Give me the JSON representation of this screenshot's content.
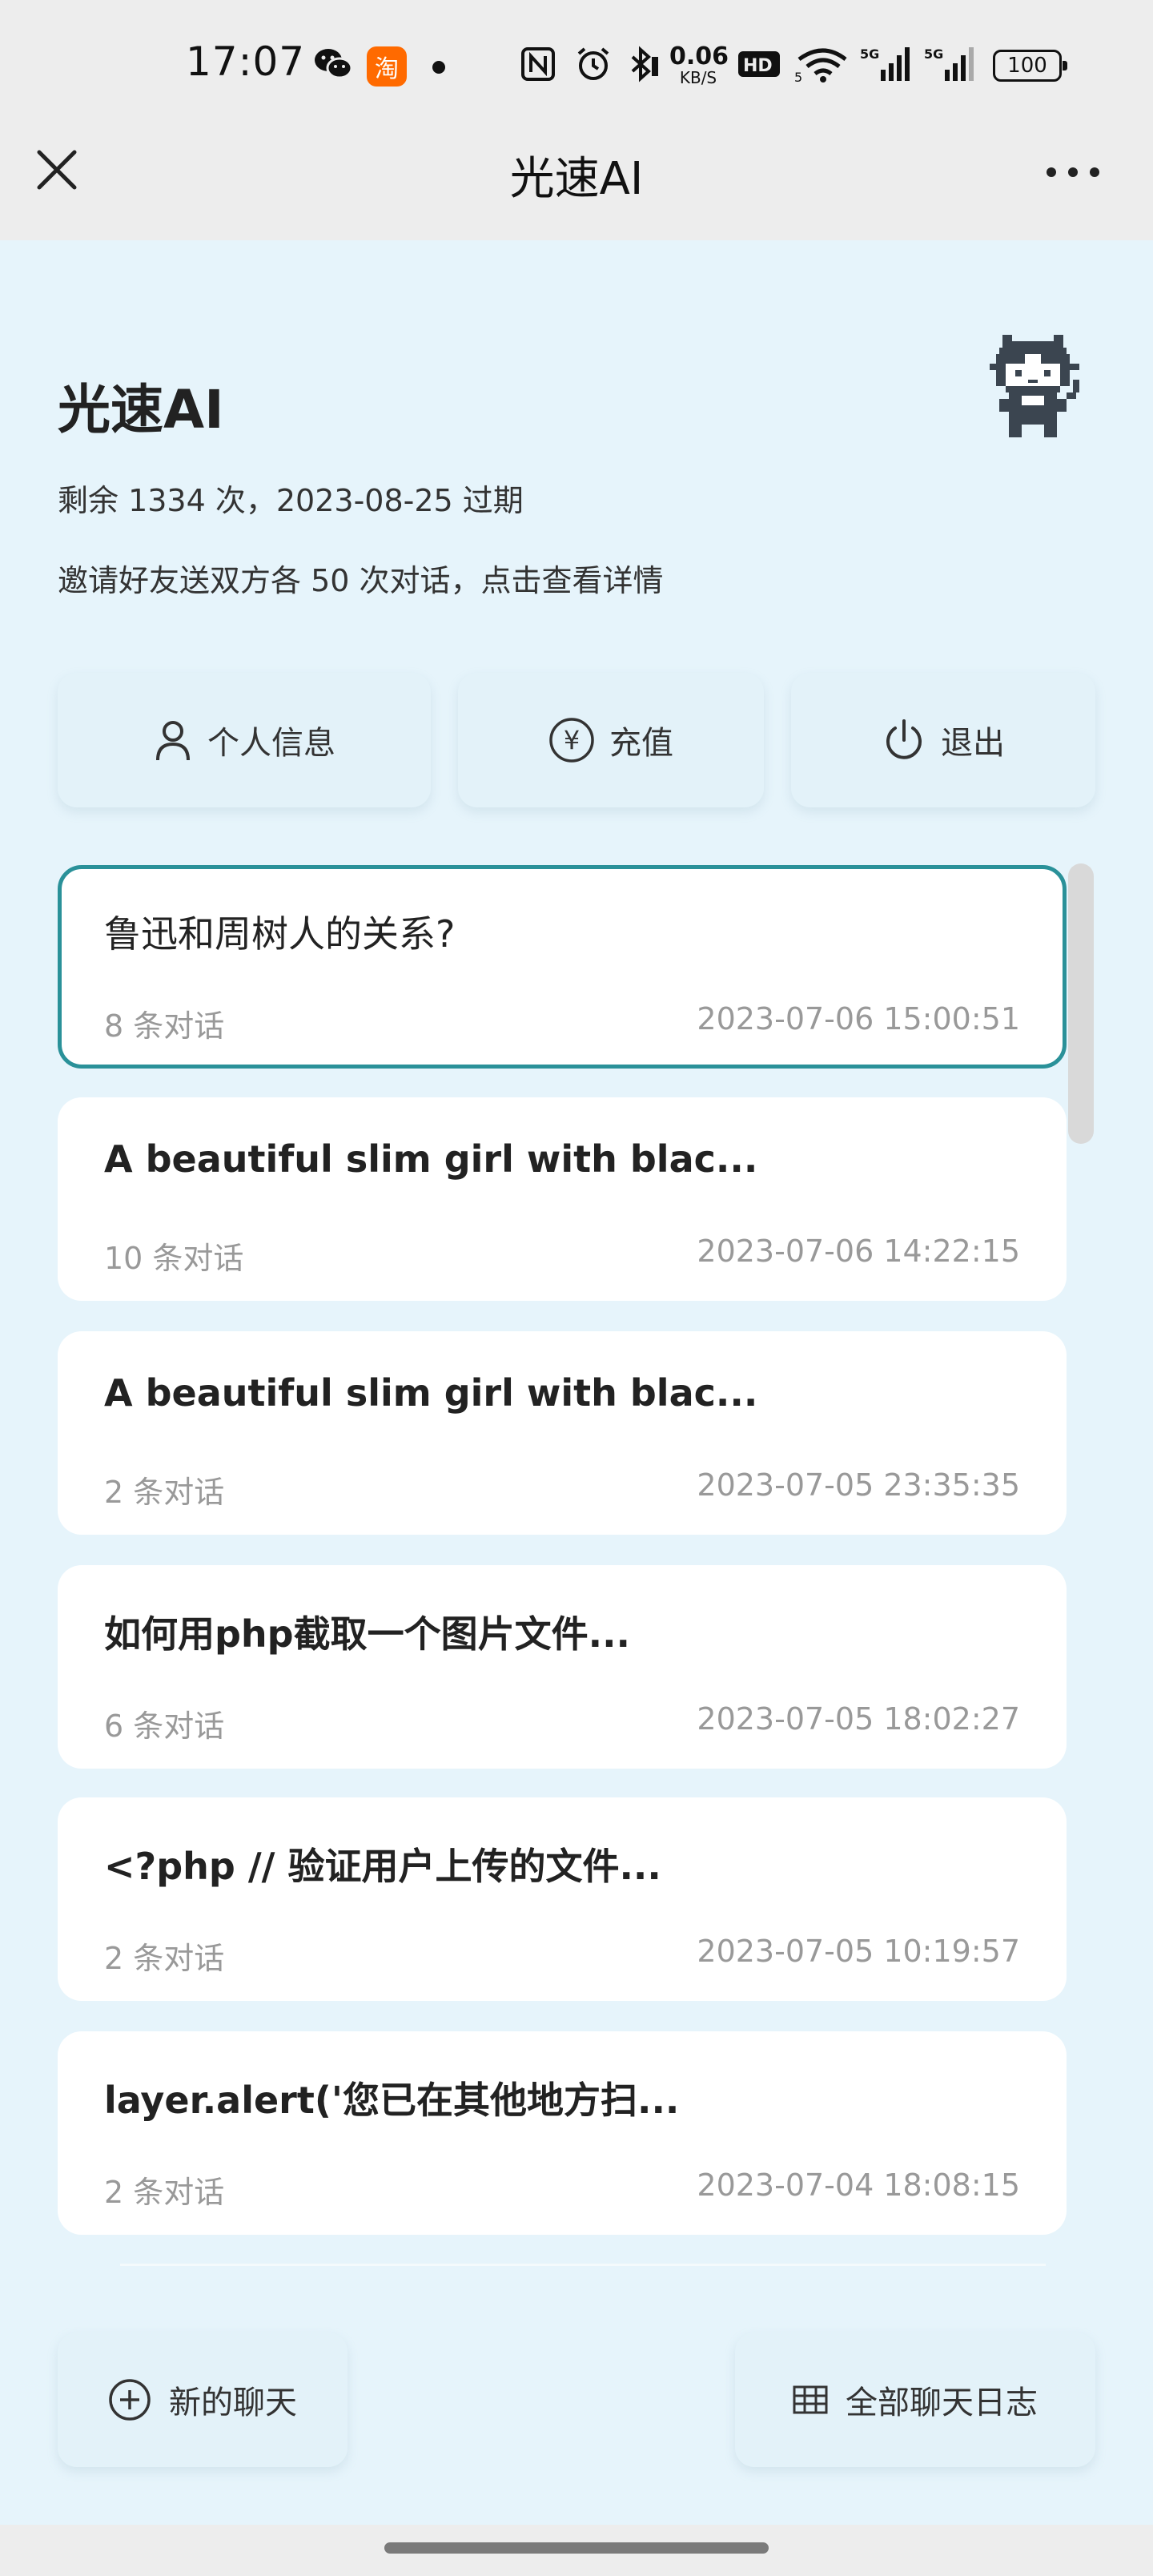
{
  "status_bar": {
    "time": "17:07",
    "taobao_icon_text": "淘",
    "network_speed": "0.06",
    "network_unit": "KB/S",
    "battery_level": "100",
    "icons": [
      "wechat-icon",
      "taobao-icon",
      "nfc-icon",
      "alarm-icon",
      "bluetooth-icon",
      "hd-icon",
      "wifi-icon",
      "signal-5g-icon",
      "signal-5g-icon"
    ]
  },
  "nav": {
    "title": "光速AI"
  },
  "header": {
    "app_name": "光速AI",
    "remaining": "剩余 1334 次，2023-08-25 过期",
    "invite": "邀请好友送双方各 50 次对话，点击查看详情"
  },
  "actions": {
    "profile": "个人信息",
    "recharge": "充值",
    "recharge_symbol": "¥",
    "logout": "退出"
  },
  "chats": [
    {
      "title": "鲁迅和周树人的关系?",
      "count": "8 条对话",
      "date": "2023-07-06 15:00:51",
      "active": true
    },
    {
      "title": "A beautiful slim girl with blac...",
      "count": "10 条对话",
      "date": "2023-07-06 14:22:15",
      "active": false
    },
    {
      "title": "A beautiful slim girl with blac...",
      "count": "2 条对话",
      "date": "2023-07-05 23:35:35",
      "active": false
    },
    {
      "title": "如何用php截取一个图片文件...",
      "count": "6 条对话",
      "date": "2023-07-05 18:02:27",
      "active": false
    },
    {
      "title": "<?php // 验证用户上传的文件...",
      "count": "2 条对话",
      "date": "2023-07-05 10:19:57",
      "active": false
    },
    {
      "title": "layer.alert('您已在其他地方扫...",
      "count": "2 条对话",
      "date": "2023-07-04 18:08:15",
      "active": false
    }
  ],
  "bottom": {
    "new_chat": "新的聊天",
    "all_logs": "全部聊天日志"
  },
  "colors": {
    "page_bg": "#e6f4fb",
    "active_border": "#2a9199",
    "bar_bg": "#ededed"
  }
}
